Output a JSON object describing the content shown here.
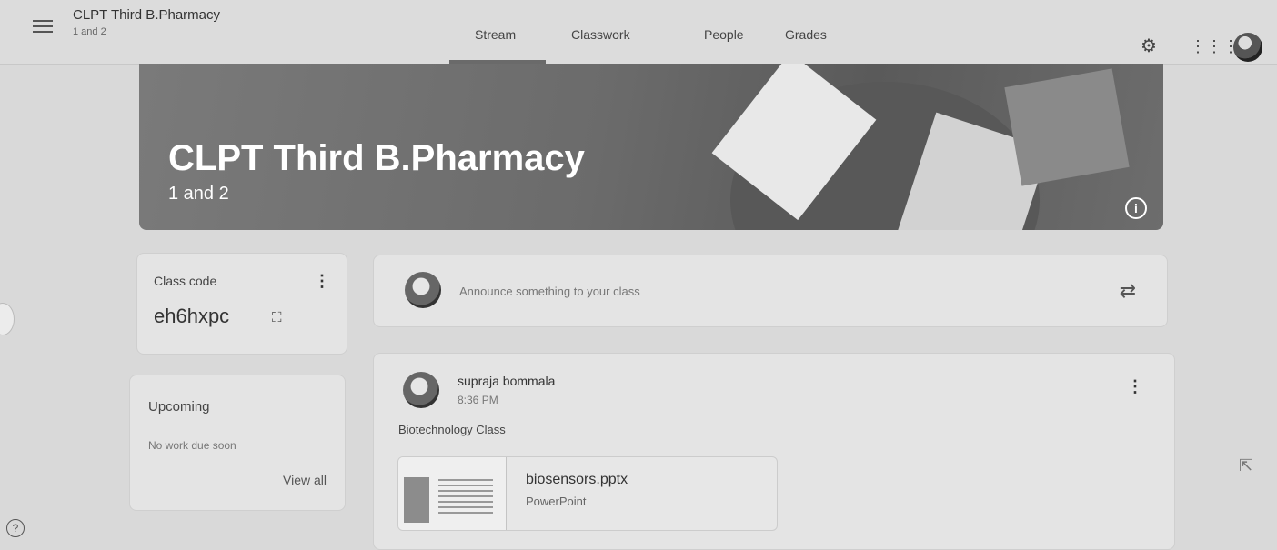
{
  "header": {
    "title": "CLPT Third B.Pharmacy",
    "subtitle": "1 and 2",
    "tabs": [
      {
        "label": "Stream",
        "active": true
      },
      {
        "label": "Classwork",
        "active": false
      },
      {
        "label": "People",
        "active": false
      },
      {
        "label": "Grades",
        "active": false
      }
    ],
    "icons": [
      "settings-icon",
      "apps-grid-icon",
      "account-avatar"
    ]
  },
  "banner": {
    "title": "CLPT Third B.Pharmacy",
    "section": "1 and 2"
  },
  "class_code": {
    "label": "Class code",
    "value": "eh6hxpc"
  },
  "upcoming": {
    "title": "Upcoming",
    "empty_text": "No work due soon",
    "view_all": "View all"
  },
  "announce": {
    "placeholder": "Announce something to your class"
  },
  "post": {
    "author": "supraja bommala",
    "time": "8:36 PM",
    "body": "Biotechnology Class",
    "attachment": {
      "name": "biosensors.pptx",
      "type": "PowerPoint"
    }
  },
  "colors": {
    "banner": "#6b6b6b",
    "background": "#d9d9d9"
  }
}
